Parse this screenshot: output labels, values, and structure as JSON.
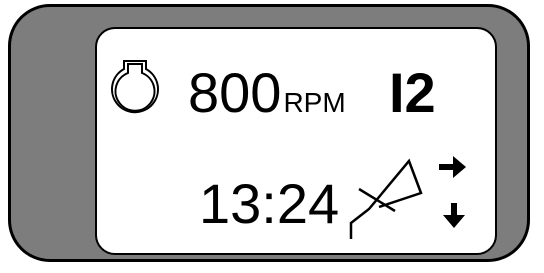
{
  "display": {
    "rpm_value": "800",
    "rpm_unit": "RPM",
    "gear": "I2",
    "clock": "13:24"
  },
  "icons": {
    "engine": "engine-oil-cap-icon",
    "implement": "hitch-arm-icon",
    "up": "arrow-right-icon",
    "down": "arrow-down-icon"
  },
  "colors": {
    "bezel": "#7d7d7d",
    "screen": "#ffffff",
    "ink": "#000000"
  }
}
